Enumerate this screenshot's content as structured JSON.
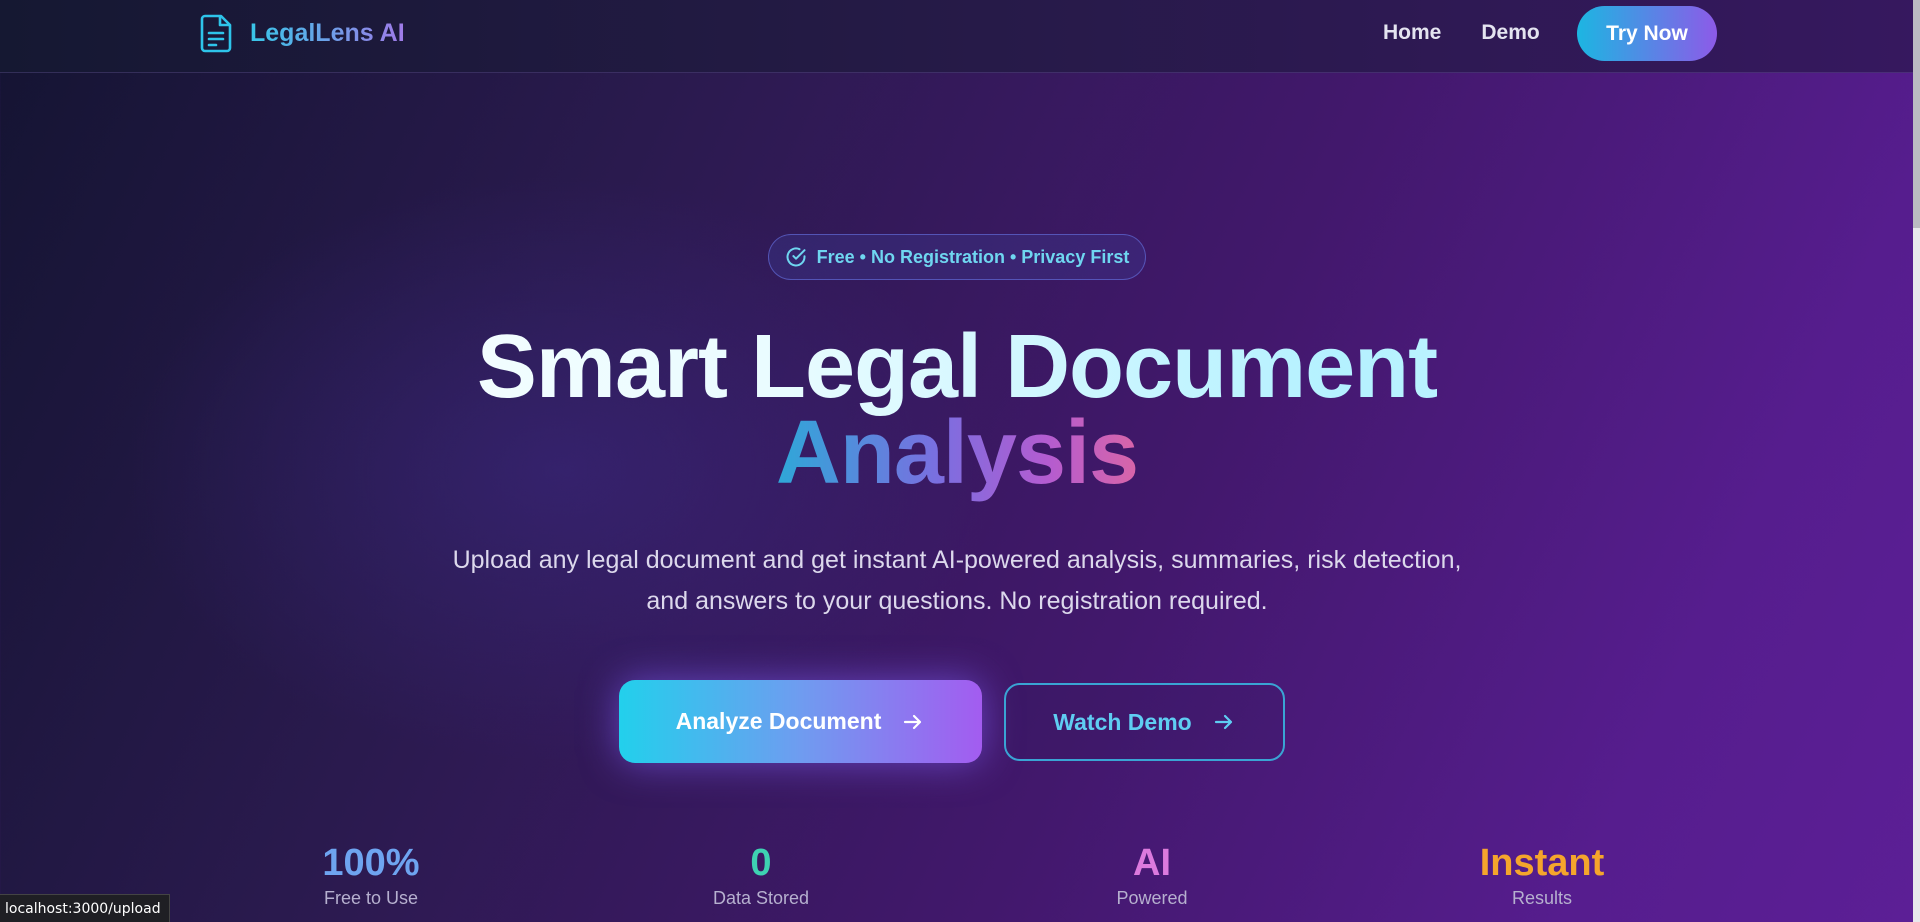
{
  "navbar": {
    "brand_name": "LegalLens AI",
    "brand_icon": "document-icon",
    "links": [
      {
        "label": "Home"
      },
      {
        "label": "Demo"
      }
    ],
    "cta_label": "Try Now"
  },
  "hero": {
    "pill": {
      "icon": "check-circle-icon",
      "text": "Free • No Registration • Privacy First"
    },
    "headline_line1": "Smart Legal Document",
    "headline_line2": "Analysis",
    "subtitle_line1": "Upload any legal document and get instant AI-powered analysis, summaries, risk detection,",
    "subtitle_line2": "and answers to your questions. No registration required.",
    "primary_button": {
      "label": "Analyze Document",
      "icon": "arrow-right-icon"
    },
    "secondary_button": {
      "label": "Watch Demo",
      "icon": "arrow-right-icon"
    }
  },
  "stats": [
    {
      "value": "100%",
      "label": "Free to Use",
      "color": "#6ea4f0"
    },
    {
      "value": "0",
      "label": "Data Stored",
      "color": "#3ed2b2"
    },
    {
      "value": "AI",
      "label": "Powered",
      "color": "#dc7ade"
    },
    {
      "value": "Instant",
      "label": "Results",
      "color": "#f5a52c"
    }
  ],
  "status_bar": {
    "url": "localhost:3000/upload"
  },
  "colors": {
    "accent_cyan": "#22d0ec",
    "accent_purple": "#a35cf0",
    "background_dark": "#141432",
    "background_purple": "#5c1f96"
  }
}
